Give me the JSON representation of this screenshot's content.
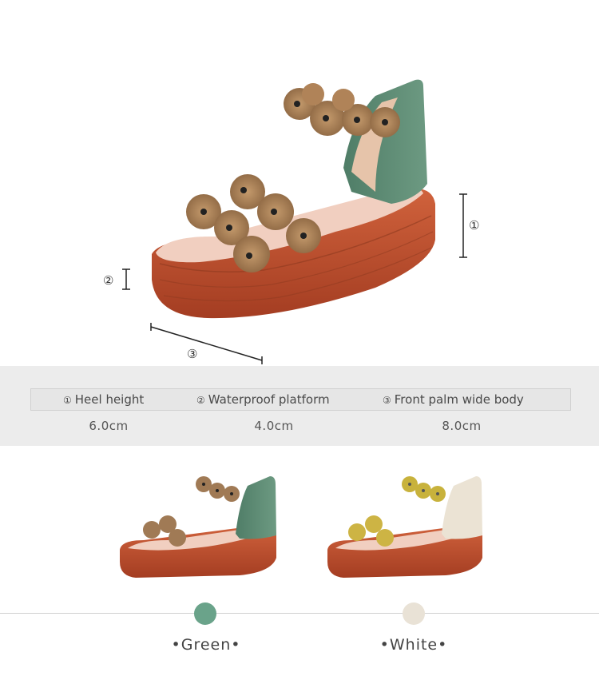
{
  "dimensions": {
    "marker_1": "①",
    "marker_2": "②",
    "marker_3": "③"
  },
  "specs": [
    {
      "num": "①",
      "label": "Heel height",
      "value": "6.0cm"
    },
    {
      "num": "②",
      "label": "Waterproof platform",
      "value": "4.0cm"
    },
    {
      "num": "③",
      "label": "Front palm wide body",
      "value": "8.0cm"
    }
  ],
  "colors": [
    {
      "name": "Green",
      "display": "•Green•",
      "hex": "#6aa38a"
    },
    {
      "name": "White",
      "display": "•White•",
      "hex": "#e9e2d6"
    }
  ],
  "icons": [
    "sandal-green-photo",
    "sandal-white-photo"
  ]
}
